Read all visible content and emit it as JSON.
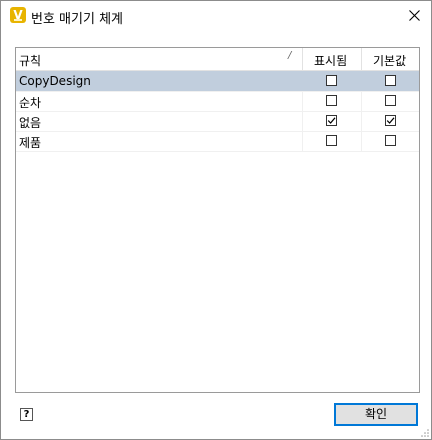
{
  "window": {
    "title": "번호 매기기 체계",
    "icon": "app-v-icon"
  },
  "table": {
    "headers": {
      "rule": "규칙",
      "sort_glyph": "/",
      "shown": "표시됨",
      "default": "기본값"
    },
    "rows": [
      {
        "name": "CopyDesign",
        "shown": false,
        "default": false,
        "selected": true
      },
      {
        "name": "순차",
        "shown": false,
        "default": false,
        "selected": false
      },
      {
        "name": "없음",
        "shown": true,
        "default": true,
        "selected": false
      },
      {
        "name": "제품",
        "shown": false,
        "default": false,
        "selected": false
      }
    ]
  },
  "footer": {
    "help_label": "?",
    "ok_label": "확인"
  }
}
